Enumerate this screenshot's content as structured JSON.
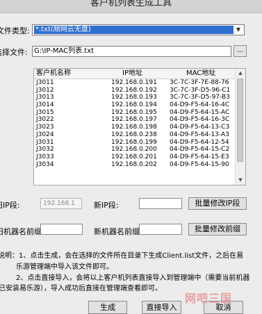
{
  "window": {
    "title": "客户机列表生成工具"
  },
  "file_type": {
    "label": "文件类型:",
    "selected": "*.txt(顺网云无盘)"
  },
  "select_file": {
    "label": "选择文件:",
    "path": "G:\\IP-MAC列表.txt",
    "browse_label": "..."
  },
  "table": {
    "columns": [
      "客户机名称",
      "IP地址",
      "MAC地址"
    ],
    "rows": [
      [
        "J3011",
        "192.168.0.191",
        "3C-7C-3F-7E-88-76"
      ],
      [
        "J3012",
        "192.168.0.192",
        "3C-7C-3F-D5-96-C1"
      ],
      [
        "J3013",
        "192.168.0.193",
        "3C-7C-3F-D5-97-B3"
      ],
      [
        "J3014",
        "192.168.0.194",
        "04-D9-F5-64-16-4C"
      ],
      [
        "J3015",
        "192.168.0.195",
        "04-D9-F5-64-15-AC"
      ],
      [
        "J3022",
        "192.168.0.197",
        "04-D9-F5-64-16-3C"
      ],
      [
        "J3023",
        "192.168.0.198",
        "04-D9-F5-64-13-C3"
      ],
      [
        "J3024",
        "192.168.0.238",
        "04-D9-F5-64-13-A3"
      ],
      [
        "J3031",
        "192.168.0.199",
        "04-D9-F5-64-12-54"
      ],
      [
        "J3032",
        "192.168.0.200",
        "04-D9-F5-64-15-C2"
      ],
      [
        "J3033",
        "192.168.0.201",
        "04-D9-F5-64-15-E3"
      ],
      [
        "J3034",
        "192.168.0.202",
        "04-D9-F5-64-15-90"
      ]
    ]
  },
  "ip_section": {
    "old_label": "旧IP段:",
    "old_value": "192.168.1",
    "new_label": "新IP段:",
    "new_value": "",
    "button": "批量修改IP段"
  },
  "prefix_section": {
    "old_label": "旧机器名前缀:",
    "old_value": "",
    "new_label": "新机器名前缀:",
    "new_value": "",
    "button": "批量修改前缀"
  },
  "notes": {
    "line1": "说明：1、点击生成，会在选择的文件所在目录下生成Client.list文件，之后在易",
    "line2": "乐游管理端中导入该文件即可。",
    "line3": "2、点击直接导入，会将以上客户机列表直接导入到管理端中（需要当前机器",
    "line4": "已安装易乐游），导入成功后直接在管理端查看即可。"
  },
  "buttons": {
    "generate": "生成",
    "import": "直接导入",
    "cancel": "取消"
  },
  "watermark": "网吧三国"
}
